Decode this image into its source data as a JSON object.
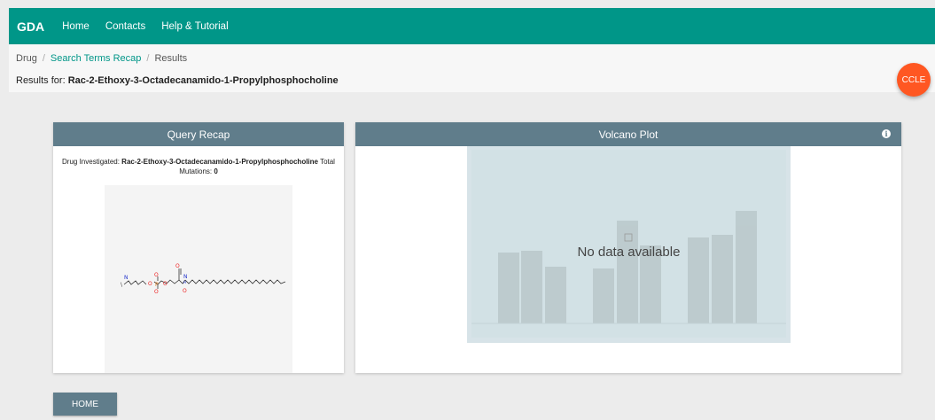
{
  "topbar": {
    "brand": "GDA",
    "nav": [
      "Home",
      "Contacts",
      "Help & Tutorial"
    ],
    "color": "#009688"
  },
  "breadcrumb": {
    "items": [
      "Drug",
      "Search Terms Recap",
      "Results"
    ]
  },
  "results": {
    "prefix": "Results for: ",
    "drug": "Rac-2-Ethoxy-3-Octadecanamido-1-Propylphosphocholine"
  },
  "ccle_button": {
    "label": "CCLE",
    "color": "#ff5722"
  },
  "query_recap": {
    "title": "Query Recap",
    "drug_label": "Drug Investigated: ",
    "drug_name": "Rac-2-Ethoxy-3-Octadecanamido-1-Propylphosphocholine",
    "mutations_label": " Total Mutations: ",
    "mutations_value": "0"
  },
  "volcano_plot": {
    "title": "Volcano Plot",
    "info_icon": "info-icon",
    "placeholder_icon": "broken-image-icon",
    "empty_message": "No data available"
  },
  "home_button": {
    "label": "HOME"
  },
  "colors": {
    "card_header": "#607d8b",
    "link": "#009688"
  }
}
